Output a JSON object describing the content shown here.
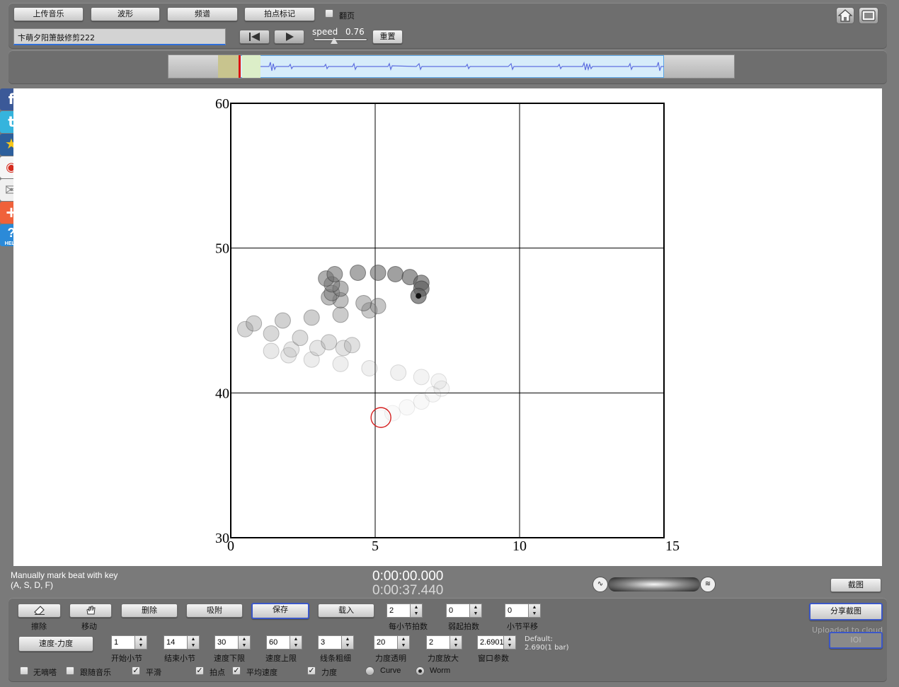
{
  "toolbar": {
    "upload_label": "上传音乐",
    "waveform_label": "波形",
    "spectrum_label": "频谱",
    "beat_mark_label": "拍点标记",
    "flip_page_label": "翻页",
    "song_title": "卞萌夕阳箫鼓修剪222",
    "speed_label": "speed",
    "speed_value": "0.76",
    "speed_level": 0.38,
    "reset_label": "重置"
  },
  "share_icons": [
    "facebook-icon",
    "twitter-icon",
    "favorite-star-icon",
    "weibo-icon",
    "mail-icon",
    "add-plus-icon",
    "help-icon"
  ],
  "help_badge": "HELP",
  "chart_data": {
    "type": "scatter",
    "title": "",
    "xlabel": "",
    "ylabel": "",
    "xlim": [
      0,
      15
    ],
    "ylim": [
      30,
      60
    ],
    "xticks": [
      "0",
      "5",
      "10",
      "15"
    ],
    "yticks": [
      "30",
      "40",
      "50",
      "60"
    ],
    "grid": true,
    "series": [
      {
        "points": [
          [
            5.2,
            38.3
          ],
          [
            5.6,
            38.6
          ],
          [
            6.1,
            39.0
          ],
          [
            6.6,
            39.4
          ],
          [
            7.0,
            39.9
          ],
          [
            7.3,
            40.3
          ],
          [
            7.2,
            40.8
          ],
          [
            6.6,
            41.1
          ],
          [
            5.8,
            41.4
          ],
          [
            4.8,
            41.7
          ],
          [
            3.8,
            42.0
          ],
          [
            2.8,
            42.3
          ],
          [
            2.0,
            42.6
          ],
          [
            1.4,
            42.9
          ],
          [
            2.1,
            43.0
          ],
          [
            3.0,
            43.1
          ],
          [
            3.9,
            43.1
          ],
          [
            4.2,
            43.3
          ],
          [
            3.4,
            43.5
          ],
          [
            2.4,
            43.8
          ],
          [
            1.4,
            44.1
          ],
          [
            0.5,
            44.4
          ],
          [
            0.8,
            44.8
          ],
          [
            1.8,
            45.0
          ],
          [
            2.8,
            45.2
          ],
          [
            3.8,
            45.4
          ],
          [
            4.8,
            45.7
          ],
          [
            5.1,
            46.0
          ],
          [
            4.6,
            46.2
          ],
          [
            3.8,
            46.4
          ],
          [
            3.4,
            46.6
          ],
          [
            3.5,
            46.9
          ],
          [
            3.8,
            47.2
          ],
          [
            3.5,
            47.5
          ],
          [
            3.3,
            47.9
          ],
          [
            3.6,
            48.2
          ],
          [
            4.4,
            48.3
          ],
          [
            5.1,
            48.3
          ],
          [
            5.7,
            48.2
          ],
          [
            6.2,
            48.0
          ],
          [
            6.6,
            47.6
          ],
          [
            6.6,
            47.2
          ],
          [
            6.5,
            46.7
          ]
        ]
      }
    ]
  },
  "current_marker": {
    "x": 5.2,
    "y": 38.3
  },
  "hint_line1": "Manually mark beat with key",
  "hint_line2": "(A, S, D, F)",
  "time_current": "0:00:00.000",
  "time_total": "0:00:37.440",
  "screenshot_label": "截图",
  "share_screenshot_label": "分享截图",
  "uploaded_label": "Uploaded to cloud",
  "ioi_label": "IOI",
  "controls": {
    "erase_label": "擦除",
    "move_label": "移动",
    "delete_label": "删除",
    "snap_label": "吸附",
    "save_label": "保存",
    "load_label": "载入",
    "beats_per_bar": {
      "value": "2",
      "label": "每小节拍数"
    },
    "pickup_beats": {
      "value": "0",
      "label": "弱起拍数"
    },
    "bar_shift": {
      "value": "0",
      "label": "小节平移"
    },
    "tempo_loudness_label": "速度-力度",
    "start_bar": {
      "value": "1",
      "label": "开始小节"
    },
    "end_bar": {
      "value": "14",
      "label": "结束小节"
    },
    "tempo_min": {
      "value": "30",
      "label": "速度下限"
    },
    "tempo_max": {
      "value": "60",
      "label": "速度上限"
    },
    "line_width": {
      "value": "3",
      "label": "线条粗细"
    },
    "loudness_alpha": {
      "value": "20",
      "label": "力度透明"
    },
    "loudness_scale": {
      "value": "2",
      "label": "力度放大"
    },
    "window_param": {
      "value": "2.6901",
      "label": "窗口参数"
    },
    "default_line1": "Default:",
    "default_line2": "2.690(1 bar)",
    "metronome_label": "无嘀嗒",
    "follow_music_label": "跟随音乐",
    "smooth_label": "平滑",
    "beat_points_label": "拍点",
    "avg_tempo_label": "平均速度",
    "loudness_label": "力度",
    "curve_label": "Curve",
    "worm_label": "Worm"
  }
}
